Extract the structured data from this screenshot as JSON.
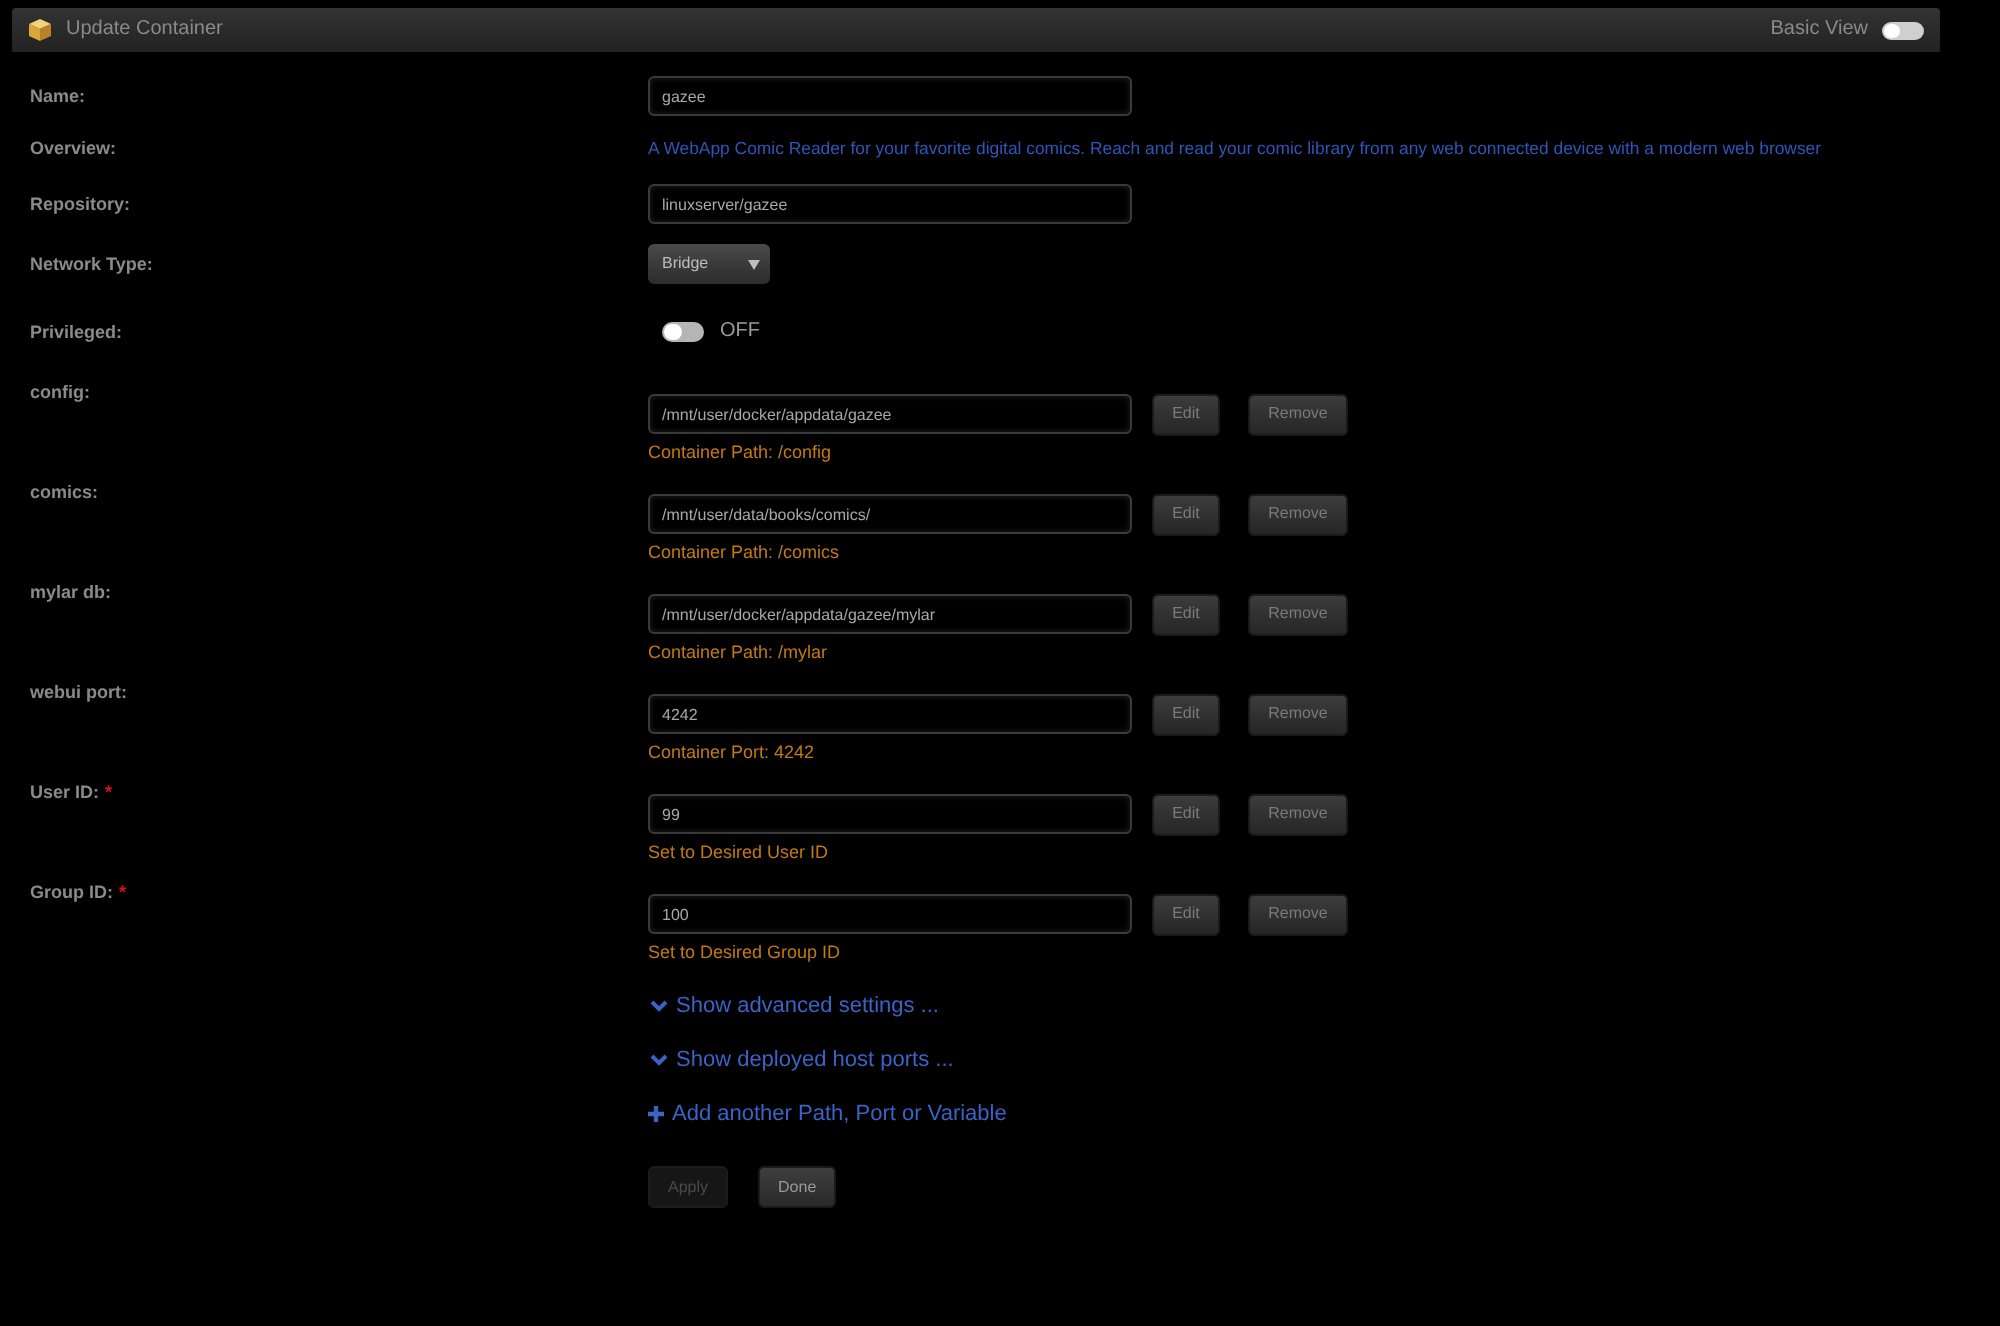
{
  "window": {
    "title": "Update Container",
    "view_toggle": {
      "label": "Basic View",
      "on": false
    }
  },
  "settings": [
    {
      "kind": "text",
      "label": "Name:",
      "value": "gazee"
    },
    {
      "kind": "description",
      "label": "Overview:",
      "text": "A WebApp Comic Reader for your favorite digital comics. Reach and read your comic library from any web connected device with a modern web browser"
    },
    {
      "kind": "text",
      "label": "Repository:",
      "value": "linuxserver/gazee"
    },
    {
      "kind": "select",
      "label": "Network Type:",
      "value": "Bridge"
    },
    {
      "kind": "switch",
      "label": "Privileged:",
      "on": false,
      "state_label": "OFF"
    }
  ],
  "config_items": [
    {
      "label": "config:",
      "value": "/mnt/user/docker/appdata/gazee",
      "note": "Container Path: /config",
      "buttons": [
        "Edit",
        "Remove"
      ]
    },
    {
      "label": "comics:",
      "value": "/mnt/user/data/books/comics/",
      "note": "Container Path: /comics",
      "buttons": [
        "Edit",
        "Remove"
      ]
    },
    {
      "label": "mylar db:",
      "value": "/mnt/user/docker/appdata/gazee/mylar",
      "note": "Container Path: /mylar",
      "buttons": [
        "Edit",
        "Remove"
      ]
    },
    {
      "label": "webui port:",
      "value": "4242",
      "note": "Container Port: 4242",
      "buttons": [
        "Edit",
        "Remove"
      ]
    },
    {
      "label": "User ID:",
      "required_mark": "*",
      "value": "99",
      "note": "Set to Desired User ID",
      "buttons": [
        "Edit",
        "Remove"
      ]
    },
    {
      "label": "Group ID:",
      "required_mark": "*",
      "value": "100",
      "note": "Set to Desired Group ID",
      "buttons": [
        "Edit",
        "Remove"
      ]
    }
  ],
  "links": [
    {
      "kind": "expand",
      "label": "Show advanced settings ..."
    },
    {
      "kind": "expand",
      "label": "Show deployed host ports ..."
    },
    {
      "kind": "add",
      "label": "Add another Path, Port or Variable"
    }
  ],
  "actions": [
    {
      "label": "Apply",
      "disabled": true
    },
    {
      "label": "Done",
      "disabled": false
    }
  ]
}
